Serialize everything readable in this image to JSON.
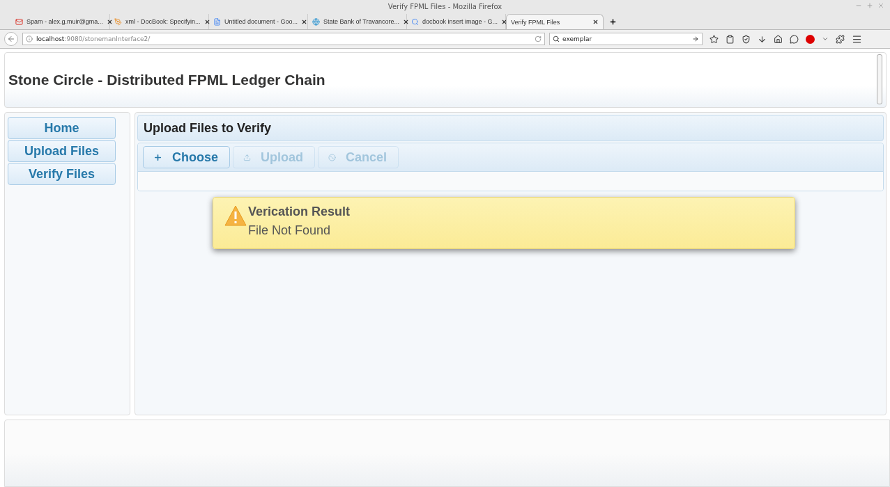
{
  "window": {
    "title": "Verify FPML Files - Mozilla Firefox"
  },
  "tabs": [
    {
      "label": "Spam - alex.g.muir@gma...",
      "selected": false
    },
    {
      "label": "xml - DocBook: Specifyin...",
      "selected": false
    },
    {
      "label": "Untitled document - Goo...",
      "selected": false
    },
    {
      "label": "State Bank of Travancore...",
      "selected": false
    },
    {
      "label": "docbook insert image - G...",
      "selected": false
    },
    {
      "label": "Verify FPML Files",
      "selected": true
    }
  ],
  "address_bar": {
    "host": "localhost",
    "path": ":9080/stonemanInterface2/"
  },
  "search": {
    "value": "exemplar"
  },
  "page": {
    "title": "Stone Circle - Distributed FPML Ledger Chain",
    "menu": [
      {
        "label": "Home"
      },
      {
        "label": "Upload Files"
      },
      {
        "label": "Verify Files"
      }
    ],
    "upload_panel": {
      "title": "Upload Files to Verify",
      "buttons": [
        {
          "label": "Choose",
          "disabled": false,
          "kind": "choose"
        },
        {
          "label": "Upload",
          "disabled": true,
          "kind": "upload"
        },
        {
          "label": "Cancel",
          "disabled": true,
          "kind": "cancel"
        }
      ]
    },
    "message": {
      "summary": "Verication Result",
      "detail": "File Not Found"
    }
  }
}
